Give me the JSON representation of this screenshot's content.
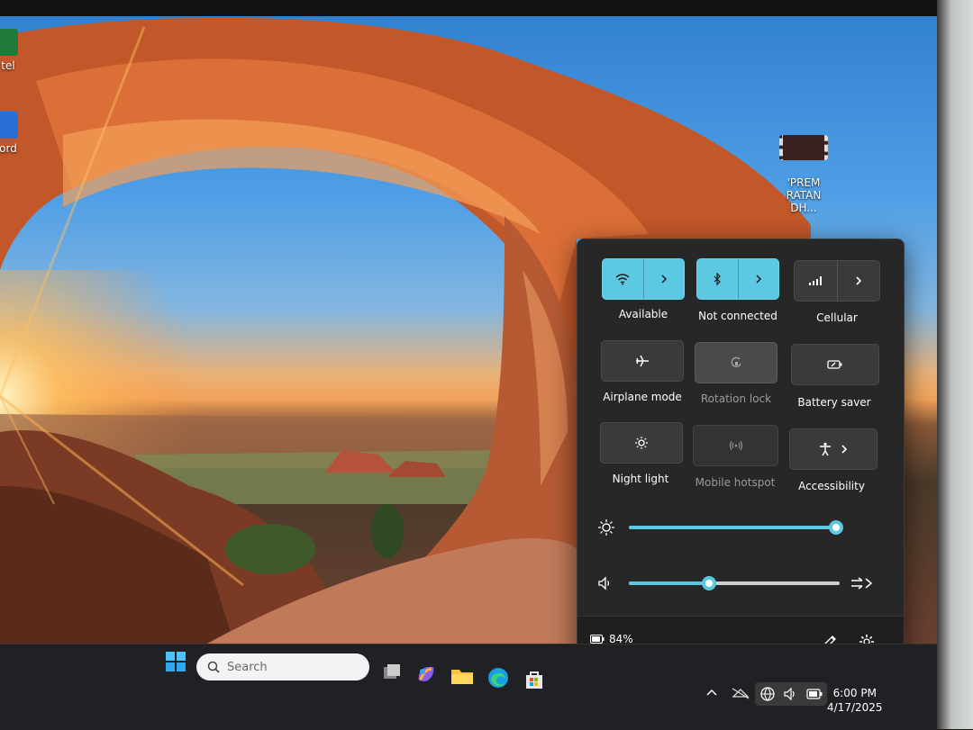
{
  "desktop": {
    "icons": [
      {
        "label": "tel",
        "color": "#1f7a3a"
      },
      {
        "label": "ord",
        "color": "#2b6fd6"
      },
      {
        "label": "'PREM\nRATAN DH...",
        "color": "#3a2020"
      }
    ]
  },
  "quick_settings": {
    "tiles": [
      {
        "label": "Available",
        "state": "on",
        "icon": "wifi-icon"
      },
      {
        "label": "Not connected",
        "state": "on",
        "icon": "bluetooth-icon"
      },
      {
        "label": "Cellular",
        "state": "off",
        "icon": "cellular-icon"
      },
      {
        "label": "Airplane mode",
        "state": "off",
        "icon": "airplane-icon"
      },
      {
        "label": "Rotation lock",
        "state": "disabled",
        "icon": "rotation-lock-icon"
      },
      {
        "label": "Battery saver",
        "state": "off",
        "icon": "battery-saver-icon"
      },
      {
        "label": "Night light",
        "state": "off",
        "icon": "night-light-icon"
      },
      {
        "label": "Mobile hotspot",
        "state": "disabled",
        "icon": "hotspot-icon"
      },
      {
        "label": "Accessibility",
        "state": "off",
        "icon": "accessibility-icon"
      }
    ],
    "brightness": {
      "value": 100,
      "icon": "brightness-icon"
    },
    "volume": {
      "value": 38,
      "icon": "volume-icon"
    },
    "battery_text": "84%",
    "accent": "#5cc8e2"
  },
  "taskbar": {
    "search_placeholder": "Search",
    "time": "6:00 PM",
    "date": "4/17/2025"
  }
}
